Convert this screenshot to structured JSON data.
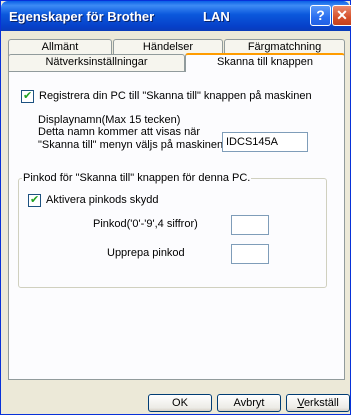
{
  "window": {
    "title": "Egenskaper för Brother",
    "title_suffix": "LAN",
    "help_glyph": "?",
    "close_glyph": "✕"
  },
  "tabs": {
    "row_back": [
      "Allmänt",
      "Händelser",
      "Färgmatchning"
    ],
    "row_front": [
      "Nätverksinställningar",
      "Skanna till knappen"
    ],
    "active": "Skanna till knappen"
  },
  "panel": {
    "register_checkbox_label": "Registrera din PC till \"Skanna till\" knappen på maskinen",
    "register_checked": true,
    "display_name_line1": "Displaynamn(Max 15 tecken)",
    "display_name_line2": "Detta namn kommer att visas när",
    "display_name_line3": "\"Skanna till\" menyn väljs på maskinen",
    "display_name_value": "IDCS145A",
    "pin_group_title": "Pinkod för \"Skanna till\" knappen för denna PC.",
    "pin_protect_label": "Aktivera pinkods skydd",
    "pin_protect_checked": true,
    "pin_label": "Pinkod('0'-'9',4 siffror)",
    "pin_value": "",
    "repeat_pin_label": "Upprepa pinkod",
    "repeat_pin_value": ""
  },
  "buttons": {
    "ok": "OK",
    "cancel": "Avbryt",
    "apply_first": "V",
    "apply_rest": "erkställ"
  },
  "colors": {
    "titlebar": "#0b58dc",
    "active_tab_accent": "#ff9c00",
    "dialog_bg": "#ece9d8"
  }
}
